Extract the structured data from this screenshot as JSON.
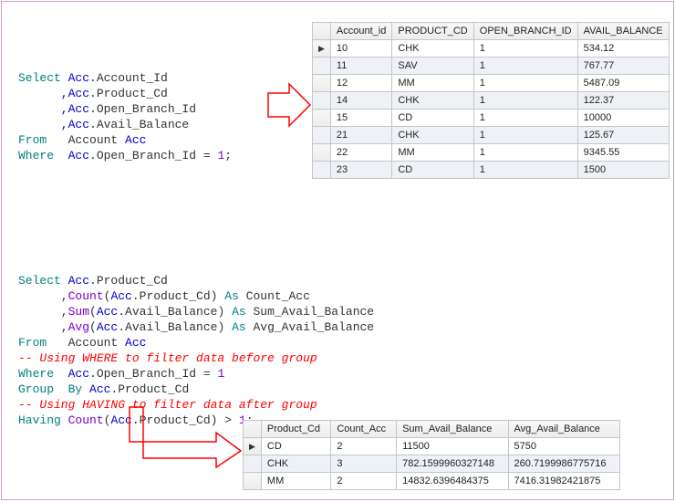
{
  "sql1": {
    "l1_kw": "Select",
    "l1_a": " Acc",
    "l1_b": ".Account_Id",
    "l2_a": "      ,Acc",
    "l2_b": ".Product_Cd",
    "l3_a": "      ,Acc",
    "l3_b": ".Open_Branch_Id",
    "l4_a": "      ,Acc",
    "l4_b": ".Avail_Balance",
    "l5_kw": "From",
    "l5_a": "   Account ",
    "l5_b": "Acc",
    "l6_kw": "Where",
    "l6_a": "  Acc",
    "l6_b": ".Open_Branch_Id = ",
    "l6_c": "1",
    "l6_d": ";"
  },
  "sql2": {
    "l1_kw": "Select",
    "l1_a": " Acc",
    "l1_b": ".Product_Cd",
    "l2_a": "      ,",
    "l2_fn": "Count",
    "l2_b": "(",
    "l2_c": "Acc",
    "l2_d": ".Product_Cd) ",
    "l2_kw": "As",
    "l2_e": " Count_Acc",
    "l3_a": "      ,",
    "l3_fn": "Sum",
    "l3_b": "(",
    "l3_c": "Acc",
    "l3_d": ".Avail_Balance) ",
    "l3_kw": "As",
    "l3_e": " Sum_Avail_Balance",
    "l4_a": "      ,",
    "l4_fn": "Avg",
    "l4_b": "(",
    "l4_c": "Acc",
    "l4_d": ".Avail_Balance) ",
    "l4_kw": "As",
    "l4_e": " Avg_Avail_Balance",
    "l5_kw": "From",
    "l5_a": "   Account ",
    "l5_b": "Acc",
    "l6_cm": "-- Using WHERE to filter data before group",
    "l7_kw": "Where",
    "l7_a": "  Acc",
    "l7_b": ".Open_Branch_Id = ",
    "l7_c": "1",
    "l8_kw": "Group  By",
    "l8_a": " Acc",
    "l8_b": ".Product_Cd",
    "l9_cm": "-- Using HAVING to filter data after group",
    "l10_kw": "Having",
    "l10_fn": " Count",
    "l10_a": "(",
    "l10_b": "Acc",
    "l10_c": ".Product_Cd) > ",
    "l10_d": "1",
    "l10_e": ";"
  },
  "t1": {
    "h": [
      "Account_id",
      "PRODUCT_CD",
      "OPEN_BRANCH_ID",
      "AVAIL_BALANCE"
    ],
    "rows": [
      [
        "10",
        "CHK",
        "1",
        "534.12"
      ],
      [
        "11",
        "SAV",
        "1",
        "767.77"
      ],
      [
        "12",
        "MM",
        "1",
        "5487.09"
      ],
      [
        "14",
        "CHK",
        "1",
        "122.37"
      ],
      [
        "15",
        "CD",
        "1",
        "10000"
      ],
      [
        "21",
        "CHK",
        "1",
        "125.67"
      ],
      [
        "22",
        "MM",
        "1",
        "9345.55"
      ],
      [
        "23",
        "CD",
        "1",
        "1500"
      ]
    ]
  },
  "t2": {
    "h": [
      "Product_Cd",
      "Count_Acc",
      "Sum_Avail_Balance",
      "Avg_Avail_Balance"
    ],
    "rows": [
      [
        "CD",
        "2",
        "11500",
        "5750"
      ],
      [
        "CHK",
        "3",
        "782.1599960327148",
        "260.7199986775716"
      ],
      [
        "MM",
        "2",
        "14832.6396484375",
        "7416.31982421875"
      ]
    ]
  }
}
